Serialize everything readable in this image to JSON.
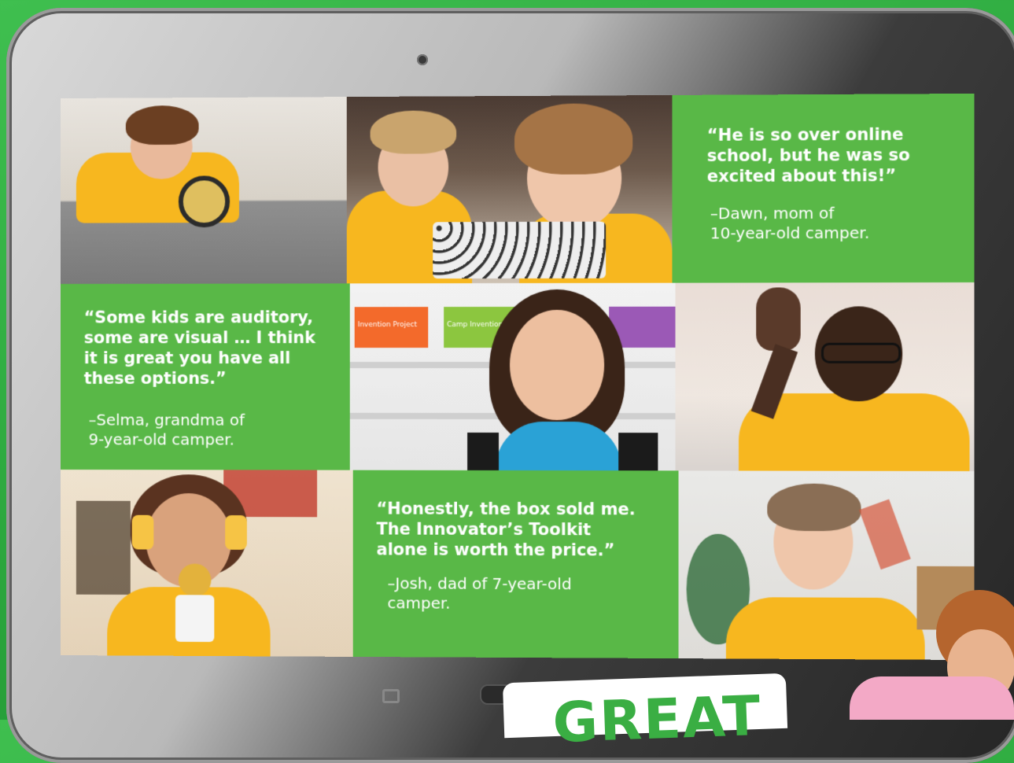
{
  "quotes": [
    {
      "text": "“He is so over online\n school, but he was so\n excited about this!”",
      "attribution": "–Dawn, mom of\n10-year-old camper."
    },
    {
      "text": "“Some kids are auditory,\n some are visual … I think\n it is great you have all\n these options.”",
      "attribution": "–Selma, grandma of\n9-year-old camper."
    },
    {
      "text": "“Honestly, the box sold me.\n The Innovator’s Toolkit\n alone is worth the price.”",
      "attribution": "–Josh, dad of 7-year-old\ncamper."
    }
  ],
  "shelf_signs": [
    "Invention Project",
    "Camp Invention"
  ],
  "banner_text": "GREAT",
  "colors": {
    "background_green": "#2aa53c",
    "quote_tile_green": "#59b847",
    "camp_shirt_yellow": "#f7b71f",
    "banner_green": "#3aae43"
  },
  "icons": [
    "camera-icon",
    "recent-apps-icon",
    "home-button-icon",
    "back-icon"
  ]
}
